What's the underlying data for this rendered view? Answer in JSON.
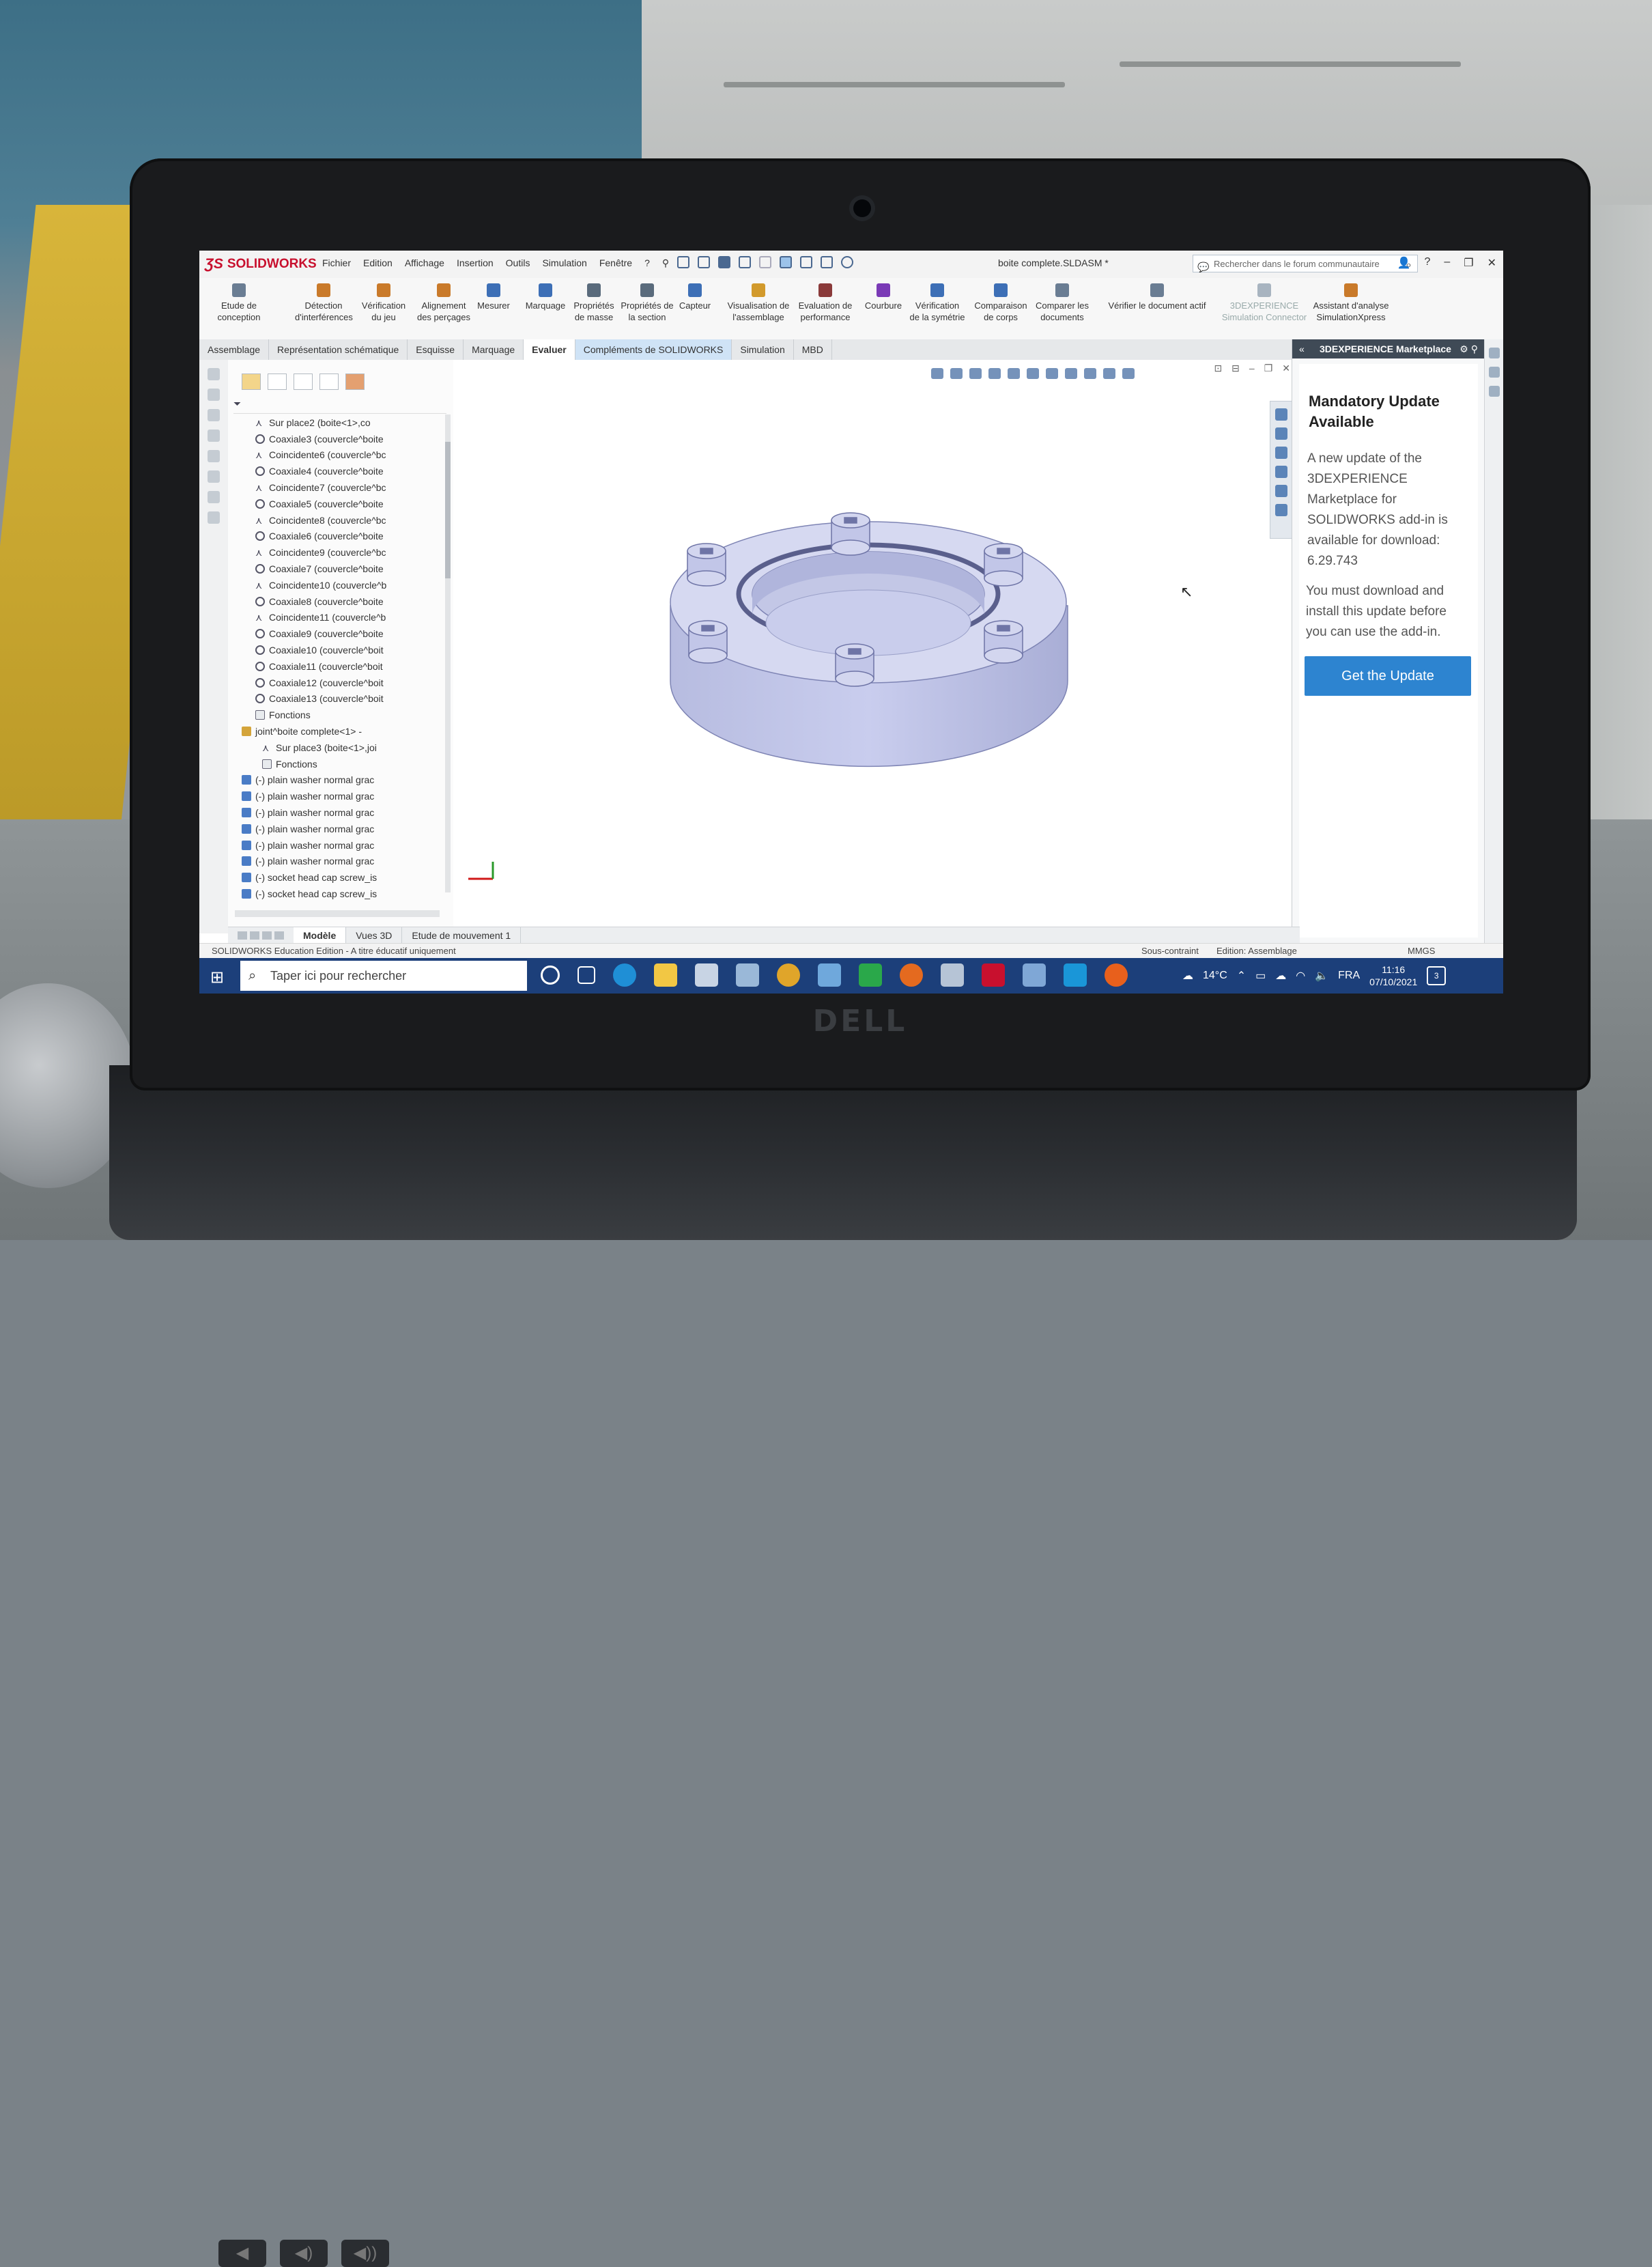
{
  "app": {
    "brand": "SOLIDWORKS",
    "menu": [
      "Fichier",
      "Edition",
      "Affichage",
      "Insertion",
      "Outils",
      "Simulation",
      "Fenêtre",
      "?"
    ],
    "document_title": "boite complete.SLDASM *",
    "search_placeholder": "Rechercher dans le forum communautaire"
  },
  "commands": [
    {
      "label": "Etude de conception",
      "color": "#6a7d93"
    },
    {
      "label": "Détection d'interférences",
      "color": "#c97a2a"
    },
    {
      "label": "Vérification du jeu",
      "color": "#c97a2a"
    },
    {
      "label": "Alignement des perçages",
      "color": "#c97a2a"
    },
    {
      "label": "Mesurer",
      "color": "#3d6fb6"
    },
    {
      "label": "Marquage",
      "color": "#3d6fb6"
    },
    {
      "label": "Propriétés de masse",
      "color": "#5a6b7c"
    },
    {
      "label": "Propriétés de la section",
      "color": "#5a6b7c"
    },
    {
      "label": "Capteur",
      "color": "#3d6fb6"
    },
    {
      "label": "Visualisation de l'assemblage",
      "color": "#d29a2c"
    },
    {
      "label": "Evaluation de performance",
      "color": "#8a3a3a"
    },
    {
      "label": "Courbure",
      "color": "#7a3ab6"
    },
    {
      "label": "Vérification de la symétrie",
      "color": "#3d6fb6"
    },
    {
      "label": "Comparaison de corps",
      "color": "#3d6fb6"
    },
    {
      "label": "Comparer les documents",
      "color": "#6a7d93"
    },
    {
      "label": "Vérifier le document actif",
      "color": "#6a7d93"
    },
    {
      "label": "3DEXPERIENCE Simulation Connector",
      "color": "#a8b4c0"
    },
    {
      "label": "Assistant d'analyse SimulationXpress",
      "color": "#c97a2a"
    }
  ],
  "tabs": [
    "Assemblage",
    "Représentation schématique",
    "Esquisse",
    "Marquage",
    "Evaluer",
    "Compléments de SOLIDWORKS",
    "Simulation",
    "MBD"
  ],
  "active_tab": "Evaluer",
  "tree_items": [
    {
      "label": "Sur place2 (boite<1>,co",
      "kind": "mate"
    },
    {
      "label": "Coaxiale3 (couvercle^boite",
      "kind": "coax"
    },
    {
      "label": "Coincidente6 (couvercle^bc",
      "kind": "mate"
    },
    {
      "label": "Coaxiale4 (couvercle^boite",
      "kind": "coax"
    },
    {
      "label": "Coincidente7 (couvercle^bc",
      "kind": "mate"
    },
    {
      "label": "Coaxiale5 (couvercle^boite",
      "kind": "coax"
    },
    {
      "label": "Coincidente8 (couvercle^bc",
      "kind": "mate"
    },
    {
      "label": "Coaxiale6 (couvercle^boite",
      "kind": "coax"
    },
    {
      "label": "Coincidente9 (couvercle^bc",
      "kind": "mate"
    },
    {
      "label": "Coaxiale7 (couvercle^boite",
      "kind": "coax"
    },
    {
      "label": "Coincidente10 (couvercle^b",
      "kind": "mate"
    },
    {
      "label": "Coaxiale8 (couvercle^boite",
      "kind": "coax"
    },
    {
      "label": "Coincidente11 (couvercle^b",
      "kind": "mate"
    },
    {
      "label": "Coaxiale9 (couvercle^boite",
      "kind": "coax"
    },
    {
      "label": "Coaxiale10 (couvercle^boit",
      "kind": "coax"
    },
    {
      "label": "Coaxiale11 (couvercle^boit",
      "kind": "coax"
    },
    {
      "label": "Coaxiale12 (couvercle^boit",
      "kind": "coax"
    },
    {
      "label": "Coaxiale13 (couvercle^boit",
      "kind": "coax"
    },
    {
      "label": "Fonctions",
      "kind": "folder"
    },
    {
      "label": "joint^boite complete<1> -",
      "kind": "comp"
    },
    {
      "label": "Sur place3 (boite<1>,joi",
      "kind": "mate"
    },
    {
      "label": "Fonctions",
      "kind": "folder"
    },
    {
      "label": "(-) plain washer normal grac",
      "kind": "part"
    },
    {
      "label": "(-) plain washer normal grac",
      "kind": "part"
    },
    {
      "label": "(-) plain washer normal grac",
      "kind": "part"
    },
    {
      "label": "(-) plain washer normal grac",
      "kind": "part"
    },
    {
      "label": "(-) plain washer normal grac",
      "kind": "part"
    },
    {
      "label": "(-) plain washer normal grac",
      "kind": "part"
    },
    {
      "label": "(-) socket head cap screw_is",
      "kind": "part"
    },
    {
      "label": "(-) socket head cap screw_is",
      "kind": "part"
    }
  ],
  "bottom_tabs": [
    "Modèle",
    "Vues 3D",
    "Etude de mouvement 1"
  ],
  "status": {
    "left": "SOLIDWORKS Education Edition - A titre éducatif uniquement",
    "constraint": "Sous-contraint",
    "mode": "Edition: Assemblage",
    "units": "MMGS"
  },
  "taskpane": {
    "header": "3DEXPERIENCE Marketplace",
    "title": "Mandatory Update Available",
    "message1": "A new update of the 3DEXPERIENCE Marketplace for SOLIDWORKS add-in is available for download: 6.29.743",
    "message2": "You must download and install this update before you can use the add-in.",
    "button": "Get the Update"
  },
  "taskbar": {
    "search_placeholder": "Taper ici pour rechercher",
    "weather": "14°C",
    "language": "FRA",
    "time": "11:16",
    "date": "07/10/2021",
    "notifications": "3"
  },
  "laptop_brand": "DELL",
  "model_color": "#c7cbe6"
}
